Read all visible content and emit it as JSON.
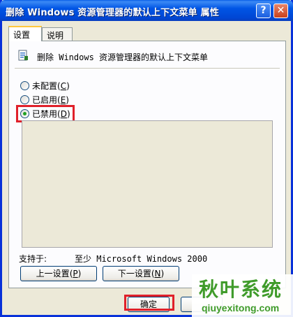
{
  "window": {
    "title": "删除 Windows 资源管理器的默认上下文菜单 属性",
    "help_glyph": "?",
    "close_glyph": "✕"
  },
  "tabs": [
    {
      "label": "设置",
      "selected": true
    },
    {
      "label": "说明",
      "selected": false
    }
  ],
  "policy": {
    "name": "删除 Windows 资源管理器的默认上下文菜单",
    "icon": "policy-setting-icon"
  },
  "options": [
    {
      "label": "未配置",
      "hotkey": "C",
      "checked": false
    },
    {
      "label": "已启用",
      "hotkey": "E",
      "checked": false
    },
    {
      "label": "已禁用",
      "hotkey": "D",
      "checked": true
    }
  ],
  "supported": {
    "label": "支持于:",
    "value": "至少 Microsoft Windows 2000"
  },
  "buttons": {
    "prev": {
      "label": "上一设置",
      "hotkey": "P"
    },
    "next": {
      "label": "下一设置",
      "hotkey": "N"
    },
    "ok": "确定"
  },
  "watermark": {
    "brand_cn": "秋叶系统",
    "brand_url": "qiuyexitong.com"
  },
  "colors": {
    "title_bar": "#0055e5",
    "highlight_border": "#e0202a",
    "watermark_green": "#3f9b2a"
  }
}
